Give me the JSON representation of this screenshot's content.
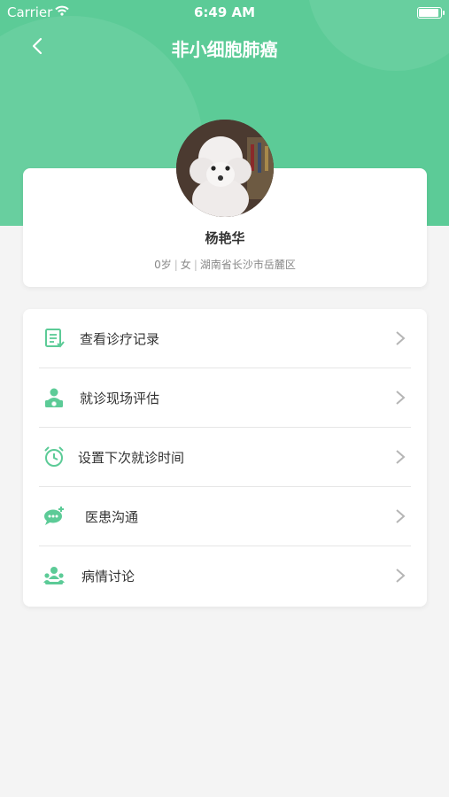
{
  "status_bar": {
    "carrier": "Carrier",
    "time": "6:49 AM"
  },
  "header": {
    "title": "非小细胞肺癌"
  },
  "patient": {
    "name": "杨艳华",
    "age": "0岁",
    "sex": "女",
    "location": "湖南省长沙市岳麓区"
  },
  "menu": {
    "items": [
      {
        "label": "查看诊疗记录",
        "icon": "record-icon"
      },
      {
        "label": "就诊现场评估",
        "icon": "doctor-icon"
      },
      {
        "label": "设置下次就诊时间",
        "icon": "alarm-clock-icon"
      },
      {
        "label": "医患沟通",
        "icon": "chat-bubble-icon"
      },
      {
        "label": "病情讨论",
        "icon": "group-discussion-icon"
      }
    ]
  },
  "colors": {
    "accent": "#5ccb97",
    "background": "#f4f4f4",
    "card": "#ffffff",
    "text": "#333333",
    "subtext": "#888888"
  }
}
